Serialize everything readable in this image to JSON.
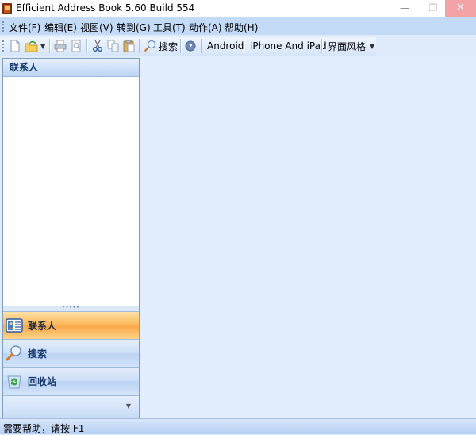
{
  "window": {
    "title": "Efficient Address Book 5.60 Build 554",
    "controls": {
      "minimize": "—",
      "maximize": "❐",
      "close": "✕"
    }
  },
  "menubar": {
    "items": [
      {
        "label": "文件(F)"
      },
      {
        "label": "编辑(E)"
      },
      {
        "label": "视图(V)"
      },
      {
        "label": "转到(G)"
      },
      {
        "label": "工具(T)"
      },
      {
        "label": "动作(A)"
      },
      {
        "label": "帮助(H)"
      }
    ]
  },
  "toolbar": {
    "search_label": "搜索",
    "android_label": "Android",
    "iphone_label": "iPhone And iPad",
    "skin_label": "界面风格",
    "dropdown_arrow": "▼",
    "icons": [
      "new-icon",
      "open-icon",
      "print-icon",
      "print-preview-icon",
      "cut-icon",
      "copy-icon",
      "paste-icon",
      "search-icon",
      "help-icon"
    ]
  },
  "left_pane": {
    "header": "联系人",
    "splitter_grip": "•••••",
    "nav": [
      {
        "label": "联系人",
        "icon": "contact-card-icon",
        "active": true
      },
      {
        "label": "搜索",
        "icon": "magnifier-icon",
        "active": false
      },
      {
        "label": "回收站",
        "icon": "recycle-bin-icon",
        "active": false
      }
    ],
    "nav_more": "▼"
  },
  "statusbar": {
    "text": "需要帮助，请按 F1"
  }
}
